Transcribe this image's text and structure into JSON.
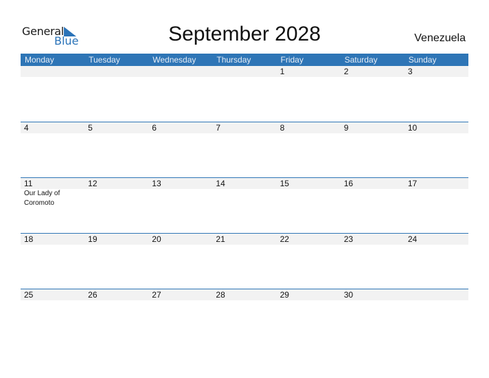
{
  "logo": {
    "word1": "General",
    "word2": "Blue"
  },
  "title": "September 2028",
  "country": "Venezuela",
  "weekdays": [
    "Monday",
    "Tuesday",
    "Wednesday",
    "Thursday",
    "Friday",
    "Saturday",
    "Sunday"
  ],
  "weeks": [
    {
      "days": [
        {
          "num": "",
          "event": ""
        },
        {
          "num": "",
          "event": ""
        },
        {
          "num": "",
          "event": ""
        },
        {
          "num": "",
          "event": ""
        },
        {
          "num": "1",
          "event": ""
        },
        {
          "num": "2",
          "event": ""
        },
        {
          "num": "3",
          "event": ""
        }
      ]
    },
    {
      "days": [
        {
          "num": "4",
          "event": ""
        },
        {
          "num": "5",
          "event": ""
        },
        {
          "num": "6",
          "event": ""
        },
        {
          "num": "7",
          "event": ""
        },
        {
          "num": "8",
          "event": ""
        },
        {
          "num": "9",
          "event": ""
        },
        {
          "num": "10",
          "event": ""
        }
      ]
    },
    {
      "days": [
        {
          "num": "11",
          "event": "Our Lady of Coromoto"
        },
        {
          "num": "12",
          "event": ""
        },
        {
          "num": "13",
          "event": ""
        },
        {
          "num": "14",
          "event": ""
        },
        {
          "num": "15",
          "event": ""
        },
        {
          "num": "16",
          "event": ""
        },
        {
          "num": "17",
          "event": ""
        }
      ]
    },
    {
      "days": [
        {
          "num": "18",
          "event": ""
        },
        {
          "num": "19",
          "event": ""
        },
        {
          "num": "20",
          "event": ""
        },
        {
          "num": "21",
          "event": ""
        },
        {
          "num": "22",
          "event": ""
        },
        {
          "num": "23",
          "event": ""
        },
        {
          "num": "24",
          "event": ""
        }
      ]
    },
    {
      "days": [
        {
          "num": "25",
          "event": ""
        },
        {
          "num": "26",
          "event": ""
        },
        {
          "num": "27",
          "event": ""
        },
        {
          "num": "28",
          "event": ""
        },
        {
          "num": "29",
          "event": ""
        },
        {
          "num": "30",
          "event": ""
        },
        {
          "num": "",
          "event": ""
        }
      ]
    }
  ],
  "colors": {
    "accent": "#2e75b6",
    "band": "#f2f2f2"
  }
}
